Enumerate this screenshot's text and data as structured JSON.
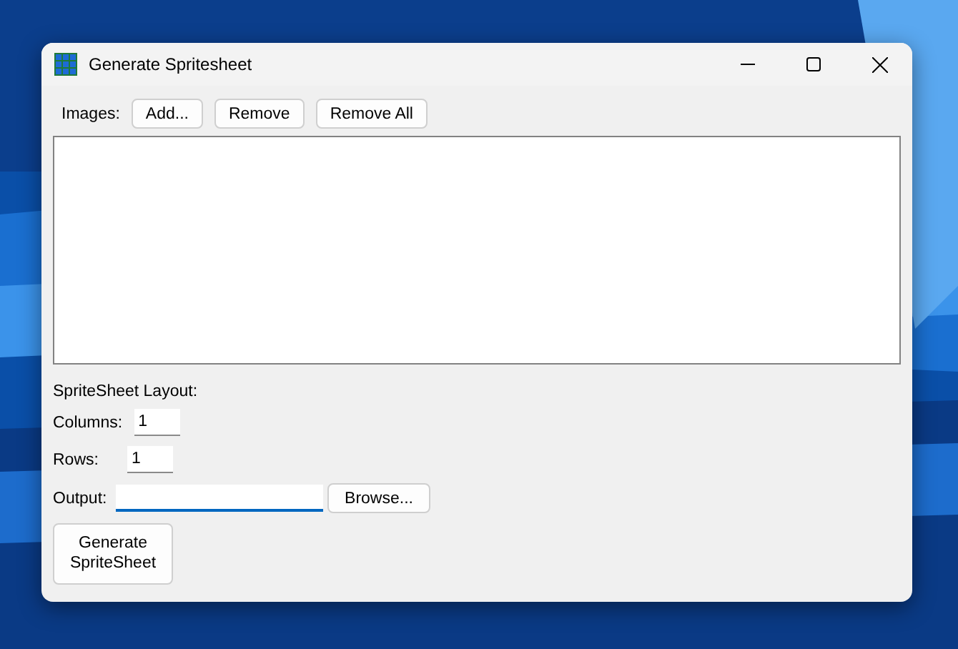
{
  "window": {
    "title": "Generate Spritesheet"
  },
  "images": {
    "label": "Images:",
    "buttons": [
      "Add...",
      "Remove",
      "Remove All"
    ]
  },
  "layout": {
    "heading": "SpriteSheet Layout:",
    "fields": [
      {
        "label": "Columns:",
        "value": "1"
      },
      {
        "label": "Rows:",
        "value": "1"
      }
    ]
  },
  "output": {
    "label": "Output:",
    "button": "Browse..."
  },
  "generate_button": "Generate\nSpriteSheet"
}
